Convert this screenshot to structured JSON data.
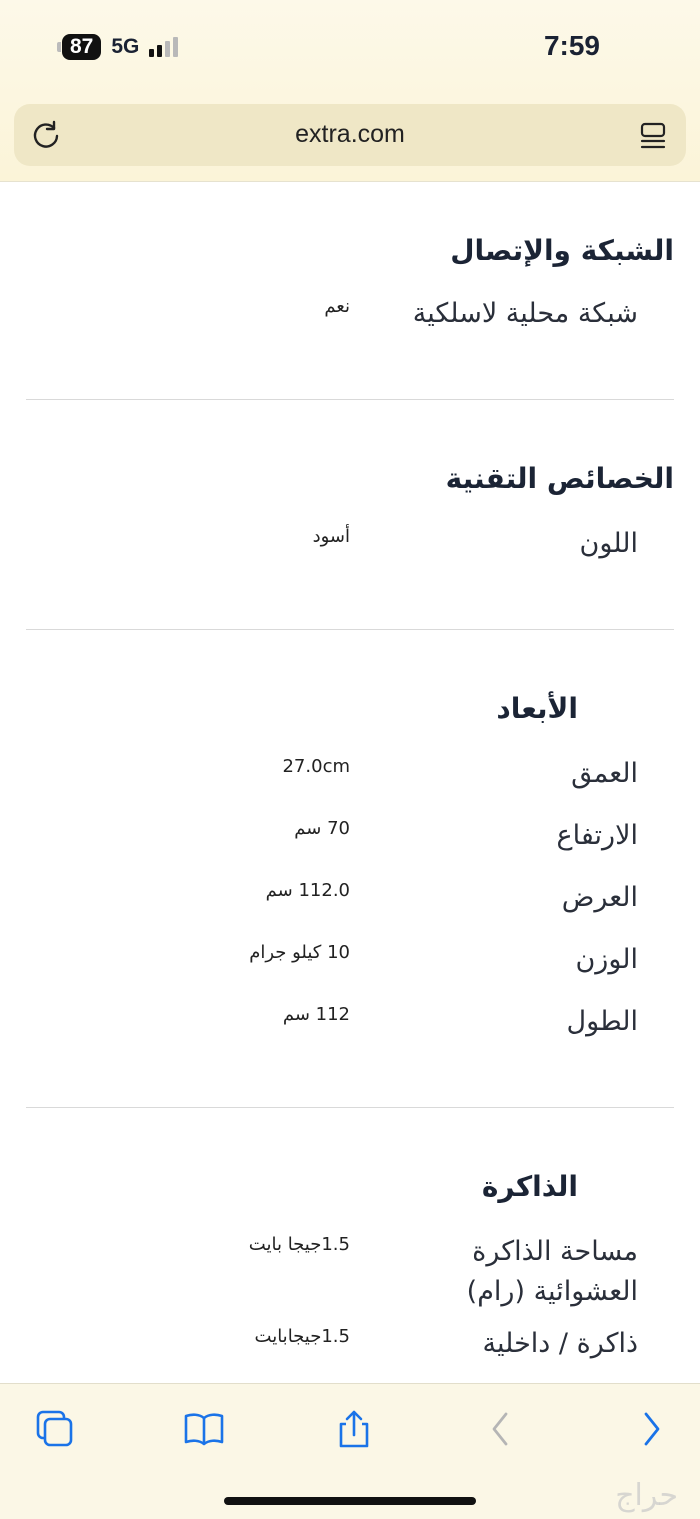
{
  "status": {
    "battery": "87",
    "network": "5G",
    "time": "7:59"
  },
  "browser": {
    "url": "extra.com"
  },
  "sections": [
    {
      "title": "الشبكة والإتصال",
      "rows": [
        {
          "label": "شبكة محلية لاسلكية",
          "value": "نعم"
        }
      ]
    },
    {
      "title": "الخصائص التقنية",
      "rows": [
        {
          "label": "اللون",
          "value": "أسود"
        }
      ]
    },
    {
      "title": "الأبعاد",
      "rows": [
        {
          "label": "العمق",
          "value": "27.0cm"
        },
        {
          "label": "الارتفاع",
          "value": "70 سم"
        },
        {
          "label": "العرض",
          "value": "112.0 سم"
        },
        {
          "label": "الوزن",
          "value": "10 كيلو جرام"
        },
        {
          "label": "الطول",
          "value": "112 سم"
        }
      ]
    },
    {
      "title": "الذاكرة",
      "rows": [
        {
          "label": "مساحة الذاكرة العشوائية (رام)",
          "value": "1.5جيجا بايت"
        },
        {
          "label": "ذاكرة / داخلية",
          "value": "1.5جيجابايت"
        }
      ]
    }
  ],
  "toolbar": {
    "tabs_icon": "tabs-icon",
    "bookmarks_icon": "book-icon",
    "share_icon": "share-icon",
    "back_icon": "chevron-left-icon",
    "forward_icon": "chevron-right-icon"
  },
  "watermark": "حراج"
}
